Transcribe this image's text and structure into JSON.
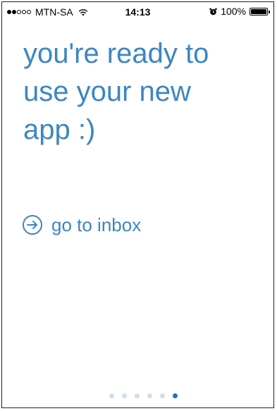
{
  "status_bar": {
    "carrier": "MTN-SA",
    "signal_bars_filled": 2,
    "signal_bars_total": 5,
    "time": "14:13",
    "battery_percent_label": "100%",
    "battery_level": 1.0,
    "icons": [
      "signal-dots-icon",
      "wifi-icon",
      "alarm-icon",
      "battery-icon"
    ]
  },
  "onboarding": {
    "heading": "you're ready to\nuse your new\napp :)",
    "inbox_link_label": "go to inbox",
    "inbox_link_icon": "arrow-right-circle-icon"
  },
  "pager": {
    "total_pages": 6,
    "current_page": 6
  },
  "colors": {
    "accent": "#3c86c3",
    "pager_inactive": "#cfdeed",
    "pager_active": "#2d6fb5"
  }
}
